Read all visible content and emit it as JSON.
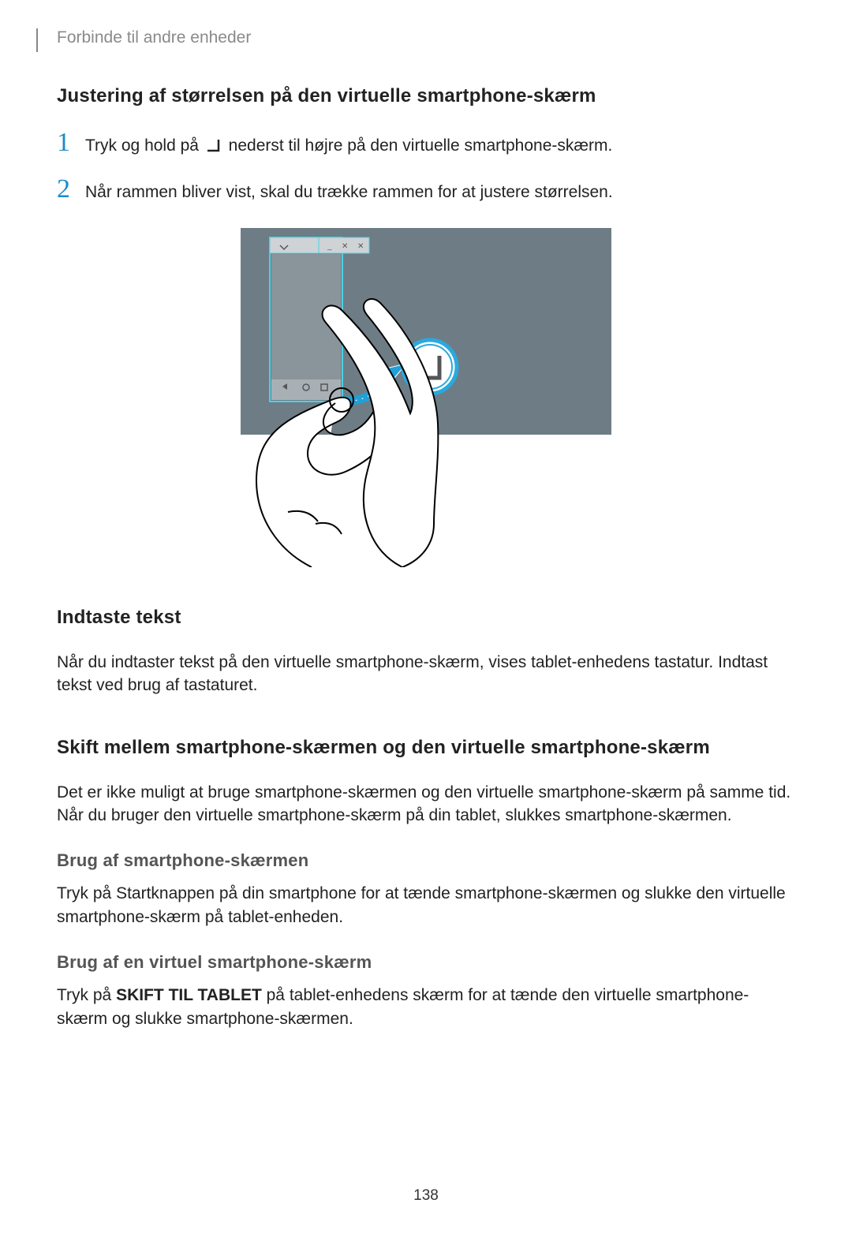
{
  "breadcrumb": "Forbinde til andre enheder",
  "section1": {
    "title": "Justering af størrelsen på den virtuelle smartphone-skærm",
    "step1_pre": "Tryk og hold på ",
    "step1_post": " nederst til højre på den virtuelle smartphone-skærm.",
    "step2": "Når rammen bliver vist, skal du trække rammen for at justere størrelsen.",
    "num1": "1",
    "num2": "2"
  },
  "section2": {
    "title": "Indtaste tekst",
    "para": "Når du indtaster tekst på den virtuelle smartphone-skærm, vises tablet-enhedens tastatur. Indtast tekst ved brug af tastaturet."
  },
  "section3": {
    "title": "Skift mellem smartphone-skærmen og den virtuelle smartphone-skærm",
    "para": "Det er ikke muligt at bruge smartphone-skærmen og den virtuelle smartphone-skærm på samme tid. Når du bruger den virtuelle smartphone-skærm på din tablet, slukkes smartphone-skærmen.",
    "sub1_title": "Brug af smartphone-skærmen",
    "sub1_para": "Tryk på Startknappen på din smartphone for at tænde smartphone-skærmen og slukke den virtuelle smartphone-skærm på tablet-enheden.",
    "sub2_title": "Brug af en virtuel smartphone-skærm",
    "sub2_pre": "Tryk på ",
    "sub2_bold": "SKIFT TIL TABLET",
    "sub2_post": " på tablet-enhedens skærm for at tænde den virtuelle smartphone-skærm og slukke smartphone-skærmen."
  },
  "page_number": "138"
}
